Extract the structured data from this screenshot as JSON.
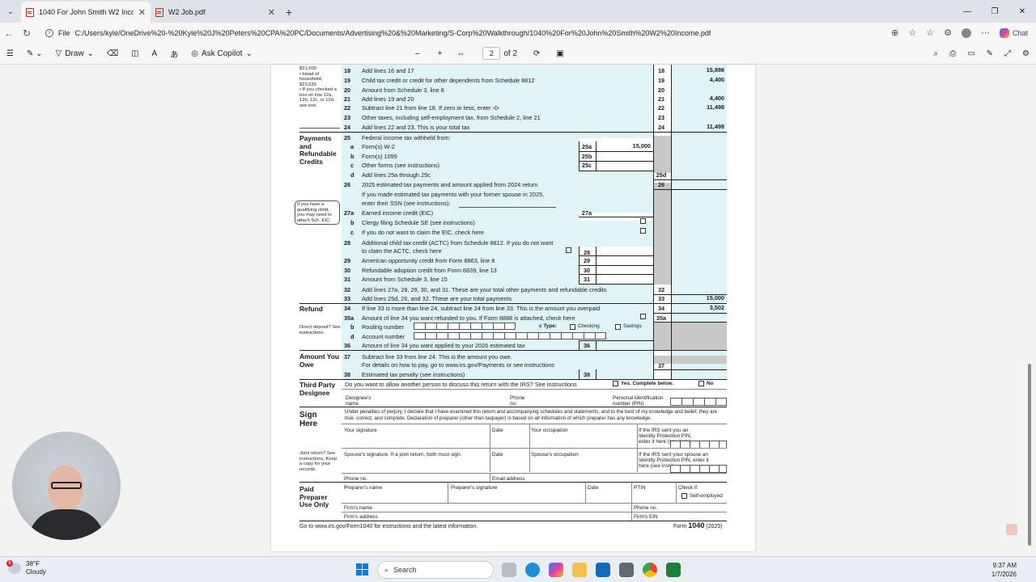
{
  "browser": {
    "tabs": [
      {
        "title": "1040 For John Smith W2 Income.pdf",
        "active": true
      },
      {
        "title": "W2 Job.pdf",
        "active": false
      }
    ],
    "file_label": "File",
    "url": "C:/Users/kyle/OneDrive%20-%20Kyle%20J%20Peters%20CPA%20PC/Documents/Advertising%20&%20Marketing/S-Corp%20Walkthrough/1040%20For%20John%20Smith%20W2%20Income.pdf",
    "copilot_label": "Chat"
  },
  "pdf_toolbar": {
    "draw": "Draw",
    "ask": "Ask Copilot",
    "page_current": "2",
    "page_total": "of 2",
    "zoom_minus": "–",
    "zoom_plus": "+"
  },
  "form": {
    "side_note": [
      "$31,500",
      "• Head of household,",
      "$23,625",
      "• If you checked a box on line 12a, 12b, 12c, or 12d, see inst."
    ],
    "lines_top": [
      {
        "n": "18",
        "d": "Add lines 16 and 17",
        "b": "18",
        "amt": "15,898"
      },
      {
        "n": "19",
        "d": "Child tax credit or credit for other dependents from Schedule 8812",
        "b": "19",
        "amt": "4,400"
      },
      {
        "n": "20",
        "d": "Amount from Schedule 3, line 8",
        "b": "20",
        "amt": ""
      },
      {
        "n": "21",
        "d": "Add lines 19 and 20",
        "b": "21",
        "amt": "4,400"
      },
      {
        "n": "22",
        "d": "Subtract line 21 from line 18. If zero or less, enter -0-",
        "b": "22",
        "amt": "11,498"
      },
      {
        "n": "23",
        "d": "Other taxes, including self-employment tax, from Schedule 2, line 21",
        "b": "23",
        "amt": ""
      },
      {
        "n": "24",
        "d": "Add lines 22 and 23. This is your total tax",
        "b": "24",
        "amt": "11,498"
      }
    ],
    "payments_title": "Payments and Refundable Credits",
    "l25": "Federal income tax withheld from:",
    "l25a": {
      "l": "a",
      "d": "Form(s) W-2",
      "b": "25a",
      "amt": "15,000"
    },
    "l25b": {
      "l": "b",
      "d": "Form(s) 1099",
      "b": "25b"
    },
    "l25c": {
      "l": "c",
      "d": "Other forms (see instructions)",
      "b": "25c"
    },
    "l25d": {
      "l": "d",
      "d": "Add lines 25a through 25c",
      "b": "25d"
    },
    "l26": {
      "n": "26",
      "d": "2025 estimated tax payments and amount applied from 2024 return",
      "b": "26"
    },
    "l26b": "If you made estimated tax payments with your former spouse in 2025,",
    "l26c": "enter their SSN (see instructions):",
    "eic_note": "If you have a qualifying child, you may need to attach Sch. EIC.",
    "l27a": {
      "n": "27a",
      "d": "Earned income credit (EIC)",
      "b": "27a"
    },
    "l27b": {
      "l": "b",
      "d": "Clergy filing Schedule SE (see instructions)"
    },
    "l27c": {
      "l": "c",
      "d": "If you do not want to claim the EIC, check here"
    },
    "l28a": "Additional child tax credit (ACTC) from Schedule 8812. If you do not want",
    "l28b": "to claim the ACTC, check here",
    "l29": {
      "n": "29",
      "d": "American opportunity credit from Form 8863, line 8",
      "b": "29"
    },
    "l30": {
      "n": "30",
      "d": "Refundable adoption credit from Form 8839, line 13",
      "b": "30"
    },
    "l31": {
      "n": "31",
      "d": "Amount from Schedule 3, line 15",
      "b": "31"
    },
    "l32": {
      "n": "32",
      "d": "Add lines 27a, 28, 29, 30, and 31. These are your total other payments and refundable credits",
      "b": "32"
    },
    "l33": {
      "n": "33",
      "d": "Add lines 25d, 26, and 32. These are your total payments",
      "b": "33",
      "amt": "15,000"
    },
    "refund_title": "Refund",
    "l34": {
      "n": "34",
      "d": "If line 33 is more than line 24, subtract line 24 from line 33. This is the amount you overpaid",
      "b": "34",
      "amt": "3,502"
    },
    "l35a": {
      "n": "35a",
      "d": "Amount of line 34 you want refunded to you. If Form 8888 is attached, check here",
      "b": "35a"
    },
    "direct_deposit": "Direct deposit? See instructions.",
    "l35b": "Routing number",
    "type_label": "c Type:",
    "checking": "Checking",
    "savings": "Savings",
    "l35d": "Account number",
    "l36": {
      "n": "36",
      "d": "Amount of line 34 you want applied to your 2026 estimated tax",
      "b": "36"
    },
    "owe_title": "Amount You Owe",
    "l37a": "Subtract line 33 from line 24. This is the amount you owe.",
    "l37b": "For details on how to pay, go to www.irs.gov/Payments or see instructions",
    "l37": {
      "n": "37",
      "b": "37"
    },
    "l38": {
      "n": "38",
      "d": "Estimated tax penalty (see instructions)",
      "b": "38"
    },
    "third_title": "Third Party Designee",
    "third_q": "Do you want to allow another person to discuss this return with the IRS? See instructions",
    "yes": "Yes. Complete below.",
    "no": "No",
    "designee_name": "Designee's name",
    "phone_no": "Phone no.",
    "pin_label": "Personal identification number (PIN)",
    "sign_title": "Sign Here",
    "perjury": "Under penalties of perjury, I declare that I have examined this return and accompanying schedules and statements, and to the best of my knowledge and belief, they are true, correct, and complete. Declaration of preparer (other than taxpayer) is based on all information of which preparer has any knowledge.",
    "your_sig": "Your signature",
    "date": "Date",
    "occupation": "Your occupation",
    "ip_pin": "If the IRS sent you an Identity Protection PIN, enter it here (see inst.)",
    "joint": "Joint return? See instructions. Keep a copy for your records.",
    "spouse_sig": "Spouse's signature. If a joint return, both must sign.",
    "spouse_occ": "Spouse's occupation",
    "spouse_pin": "If the IRS sent your spouse an Identity Protection PIN, enter it here (see inst.)",
    "phone": "Phone no.",
    "email": "Email address",
    "paid_title": "Paid Preparer Use Only",
    "prep_name": "Preparer's name",
    "prep_sig": "Preparer's signature",
    "ptin": "PTIN",
    "check_if": "Check if:",
    "self_emp": "Self-employed",
    "firm_name": "Firm's name",
    "firm_phone": "Phone no.",
    "firm_addr": "Firm's address",
    "firm_ein": "Firm's EIN",
    "footer_left": "Go to www.irs.gov/Form1040 for instructions and the latest information.",
    "footer_form": "Form",
    "footer_num": "1040",
    "footer_year": "(2025)"
  },
  "taskbar": {
    "temp": "38°F",
    "cond": "Cloudy",
    "search": "Search",
    "time": "9:37 AM",
    "date": "1/7/2026",
    "badge": "5"
  }
}
